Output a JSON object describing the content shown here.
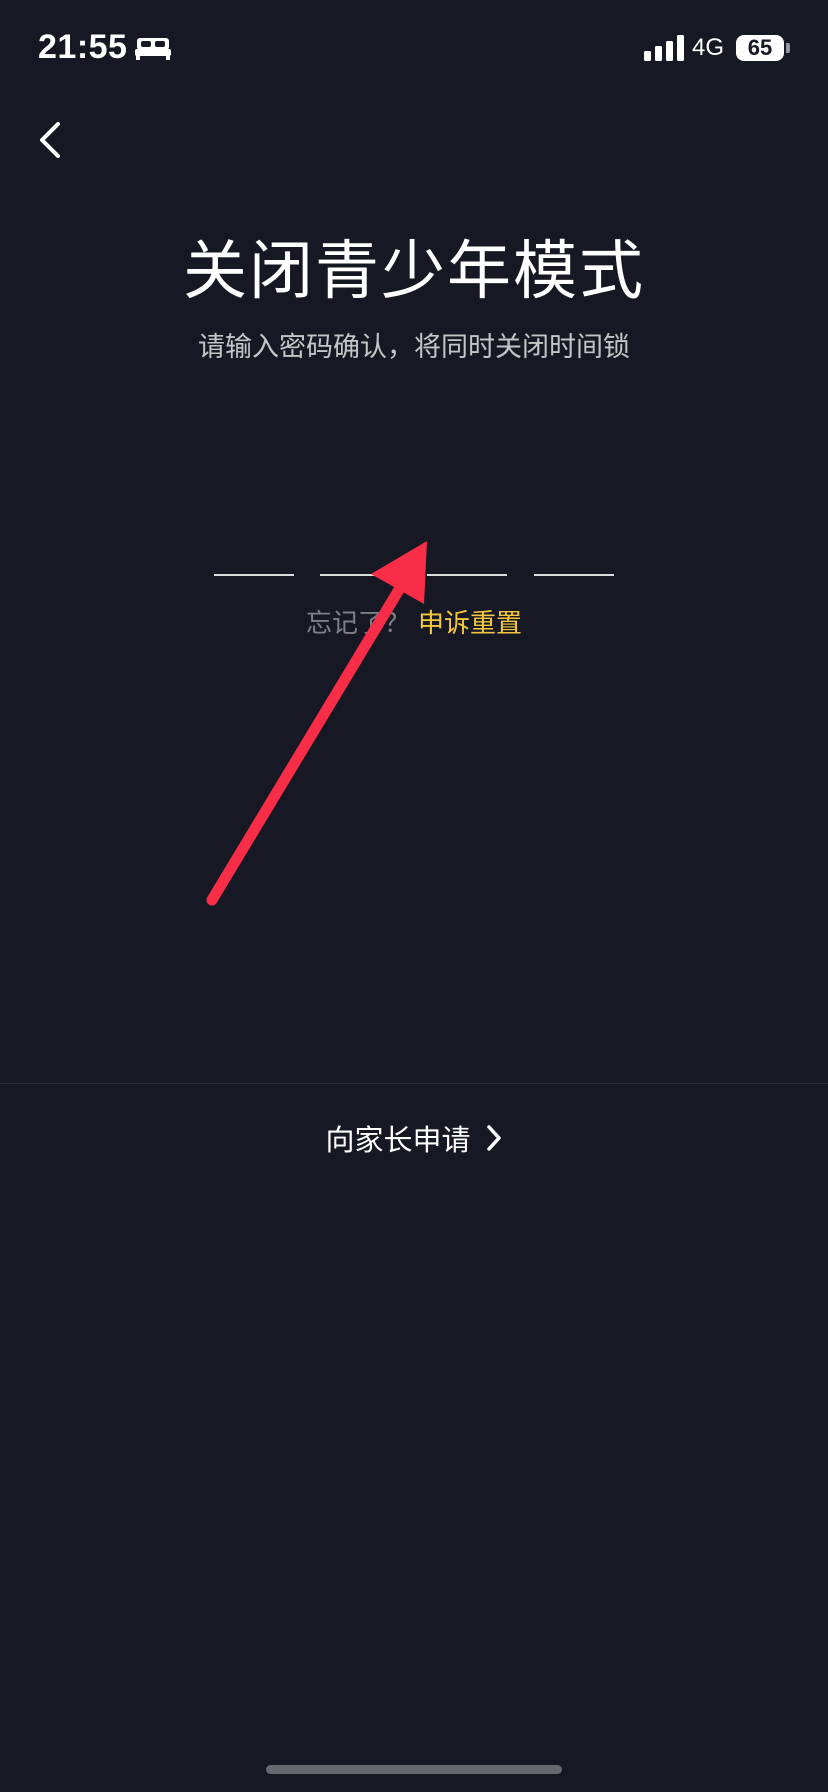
{
  "status_bar": {
    "time": "21:55",
    "sleep_icon": "bed-icon",
    "signal_icon": "signal-bars-icon",
    "network": "4G",
    "battery": "65"
  },
  "nav": {
    "back_icon": "chevron-left-icon"
  },
  "header": {
    "title": "关闭青少年模式",
    "subtitle": "请输入密码确认，将同时关闭时间锁"
  },
  "code_input": {
    "slots": 4
  },
  "forgot": {
    "prompt": "忘记了？",
    "link": "申诉重置",
    "link_color": "#f5c83f"
  },
  "parent_apply": {
    "label": "向家长申请",
    "icon": "chevron-right-icon"
  },
  "annotation": {
    "color": "#fa2d48",
    "shape": "arrow"
  },
  "colors": {
    "background": "#161823",
    "text": "#ffffff"
  }
}
